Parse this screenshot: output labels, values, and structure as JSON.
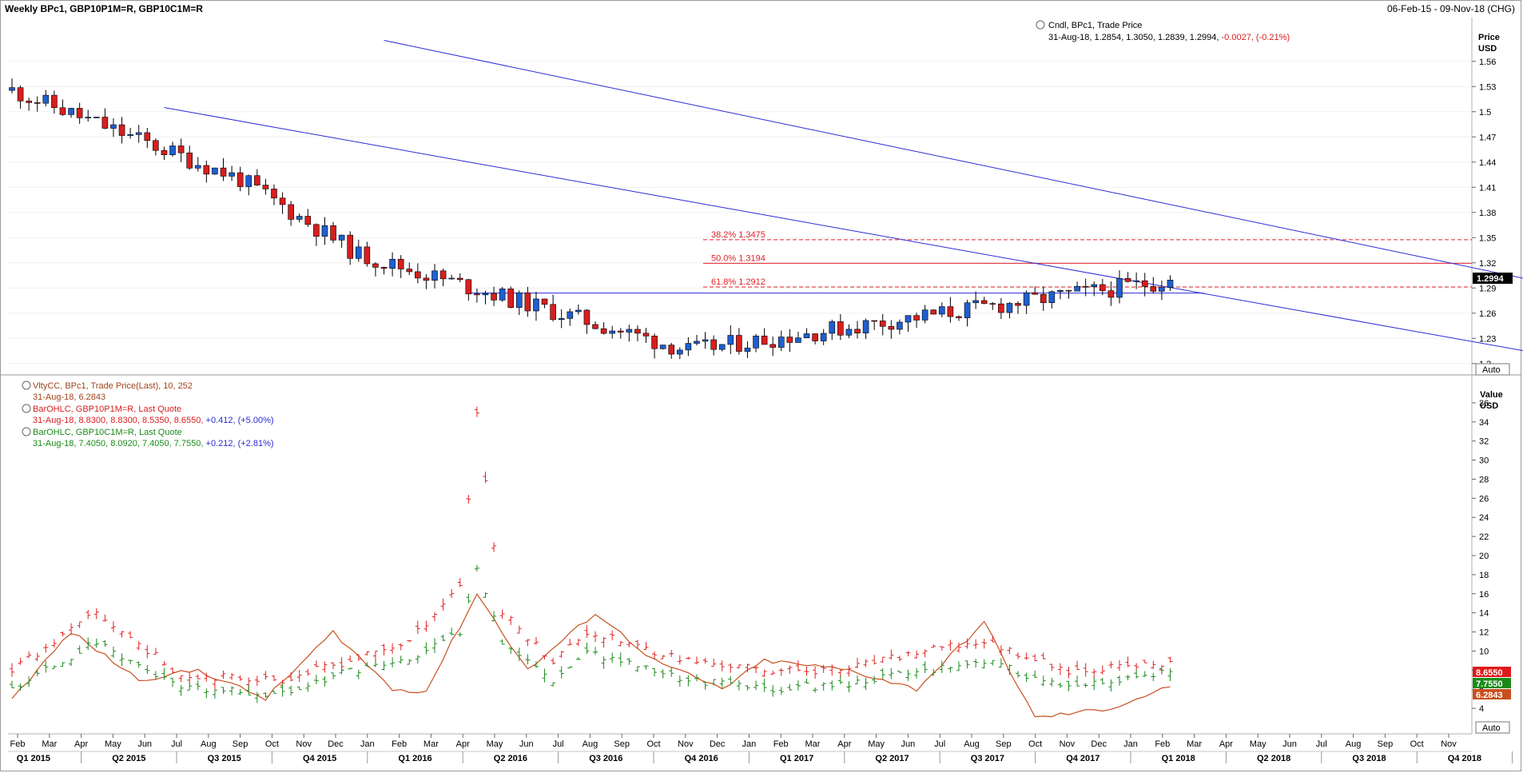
{
  "header": {
    "title": "Weekly BPc1, GBP10P1M=R, GBP10C1M=R",
    "date_range": "06-Feb-15 - 09-Nov-18 (CHG)"
  },
  "colors": {
    "up_candle": "#1f5fd0",
    "down_candle": "#d81e1e",
    "channel": "#2b2bd6",
    "fib": "#e0202a",
    "vol": "#c8501e",
    "put": "#e02020",
    "call": "#1a8a1a"
  },
  "chart_data": [
    {
      "type": "candlestick",
      "series_label": "Cndl, BPc1, Trade Price",
      "quote_prefix": "31-Aug-18, 1.2854, 1.3050, 1.2839, 1.2994,",
      "quote_change": "-0.0027, (-0.21%)",
      "last_value_label": "1.2994",
      "last_value": 1.2994,
      "y_axis_title": [
        "Price",
        "USD"
      ],
      "ylim": [
        1.195,
        1.595
      ],
      "y_ticks": [
        "1.56",
        "1.53",
        "1.5",
        "1.47",
        "1.44",
        "1.41",
        "1.38",
        "1.35",
        "1.32",
        "1.29",
        "1.26",
        "1.23",
        "1.2"
      ],
      "auto_label": "Auto",
      "fib_levels": [
        {
          "label": "38.2% 1.3475",
          "value": 1.3475,
          "style": "dashed"
        },
        {
          "label": "50.0% 1.3194",
          "value": 1.3194,
          "style": "solid"
        },
        {
          "label": "61.8% 1.2912",
          "value": 1.2912,
          "style": "dashed"
        }
      ],
      "anchor_points": [
        [
          0,
          1.5254
        ],
        [
          27,
          1.4195
        ],
        [
          41,
          1.3295
        ],
        [
          80,
          1.2154
        ],
        [
          137,
          1.2994
        ]
      ],
      "support_line_level": 1.2839,
      "channel_upper": [
        [
          44,
          1.585
        ],
        [
          258,
          1.135
        ]
      ],
      "channel_lower": [
        [
          18,
          1.505
        ],
        [
          190,
          1.195
        ]
      ]
    },
    {
      "type": "line",
      "series": [
        {
          "name": "VltyCC, BPc1, Trade Price(Last), 10, 252",
          "quote": "31-Aug-18, 6.2843",
          "last": "6.2843"
        },
        {
          "name": "BarOHLC, GBP10P1M=R, Last Quote",
          "quote_prefix": "31-Aug-18, 8.8300, 8.8300, 8.5350, 8.6550,",
          "quote_change": "+0.412, (+5.00%)",
          "last": "8.6550"
        },
        {
          "name": "BarOHLC, GBP10C1M=R, Last Quote",
          "quote_prefix": "31-Aug-18, 7.4050, 8.0920, 7.4050, 7.7550,",
          "quote_change": "+0.212, (+2.81%)",
          "last": "7.7550"
        }
      ],
      "y_axis_title": [
        "Value",
        "USD"
      ],
      "ylim": [
        2,
        38
      ],
      "y_ticks": [
        "36",
        "34",
        "32",
        "30",
        "28",
        "26",
        "24",
        "22",
        "20",
        "18",
        "16",
        "14",
        "12",
        "10",
        "8",
        "6",
        "4"
      ],
      "auto_label": "Auto",
      "vol_anchors": [
        [
          0,
          5
        ],
        [
          7,
          12
        ],
        [
          15,
          7
        ],
        [
          22,
          8
        ],
        [
          30,
          5
        ],
        [
          38,
          12
        ],
        [
          45,
          6
        ],
        [
          49,
          5.8
        ],
        [
          55,
          16
        ],
        [
          61,
          8
        ],
        [
          69,
          14
        ],
        [
          76,
          9
        ],
        [
          84,
          6
        ],
        [
          89,
          9
        ],
        [
          99,
          8
        ],
        [
          107,
          6
        ],
        [
          115,
          13
        ],
        [
          121,
          3
        ],
        [
          130,
          4
        ],
        [
          137,
          6.28
        ]
      ],
      "put_anchors": [
        [
          0,
          8
        ],
        [
          10,
          14
        ],
        [
          20,
          7.5
        ],
        [
          32,
          7
        ],
        [
          40,
          9
        ],
        [
          47,
          11
        ],
        [
          53,
          17
        ],
        [
          55,
          35
        ],
        [
          58,
          14
        ],
        [
          64,
          9
        ],
        [
          68,
          12
        ],
        [
          80,
          9
        ],
        [
          89,
          8
        ],
        [
          98,
          8
        ],
        [
          108,
          10
        ],
        [
          115,
          11
        ],
        [
          125,
          8
        ],
        [
          137,
          8.66
        ]
      ],
      "call_anchors": [
        [
          0,
          6
        ],
        [
          10,
          11
        ],
        [
          20,
          6
        ],
        [
          32,
          5.5
        ],
        [
          40,
          8
        ],
        [
          47,
          9
        ],
        [
          53,
          12
        ],
        [
          55,
          19
        ],
        [
          58,
          11
        ],
        [
          64,
          7
        ],
        [
          68,
          10
        ],
        [
          80,
          7
        ],
        [
          89,
          6
        ],
        [
          98,
          6.5
        ],
        [
          108,
          8
        ],
        [
          115,
          9
        ],
        [
          125,
          6
        ],
        [
          137,
          7.76
        ]
      ]
    }
  ],
  "x_axis": {
    "months": [
      "Feb",
      "Mar",
      "Apr",
      "May",
      "Jun",
      "Jul",
      "Aug",
      "Sep",
      "Oct",
      "Nov",
      "Dec",
      "Jan",
      "Feb",
      "Mar",
      "Apr",
      "May",
      "Jun",
      "Jul",
      "Aug",
      "Sep",
      "Oct",
      "Nov",
      "Dec",
      "Jan",
      "Feb",
      "Mar",
      "Apr",
      "May",
      "Jun",
      "Jul",
      "Aug",
      "Sep",
      "Oct",
      "Nov",
      "Dec",
      "Jan",
      "Feb",
      "Mar",
      "Apr",
      "May",
      "Jun",
      "Jul",
      "Aug",
      "Sep",
      "Oct",
      "Nov"
    ],
    "quarters": [
      "Q1 2015",
      "Q2 2015",
      "Q3 2015",
      "Q4 2015",
      "Q1 2016",
      "Q2 2016",
      "Q3 2016",
      "Q4 2016",
      "Q1 2017",
      "Q2 2017",
      "Q3 2017",
      "Q4 2017",
      "Q1 2018",
      "Q2 2018",
      "Q3 2018",
      "Q4 2018"
    ]
  }
}
